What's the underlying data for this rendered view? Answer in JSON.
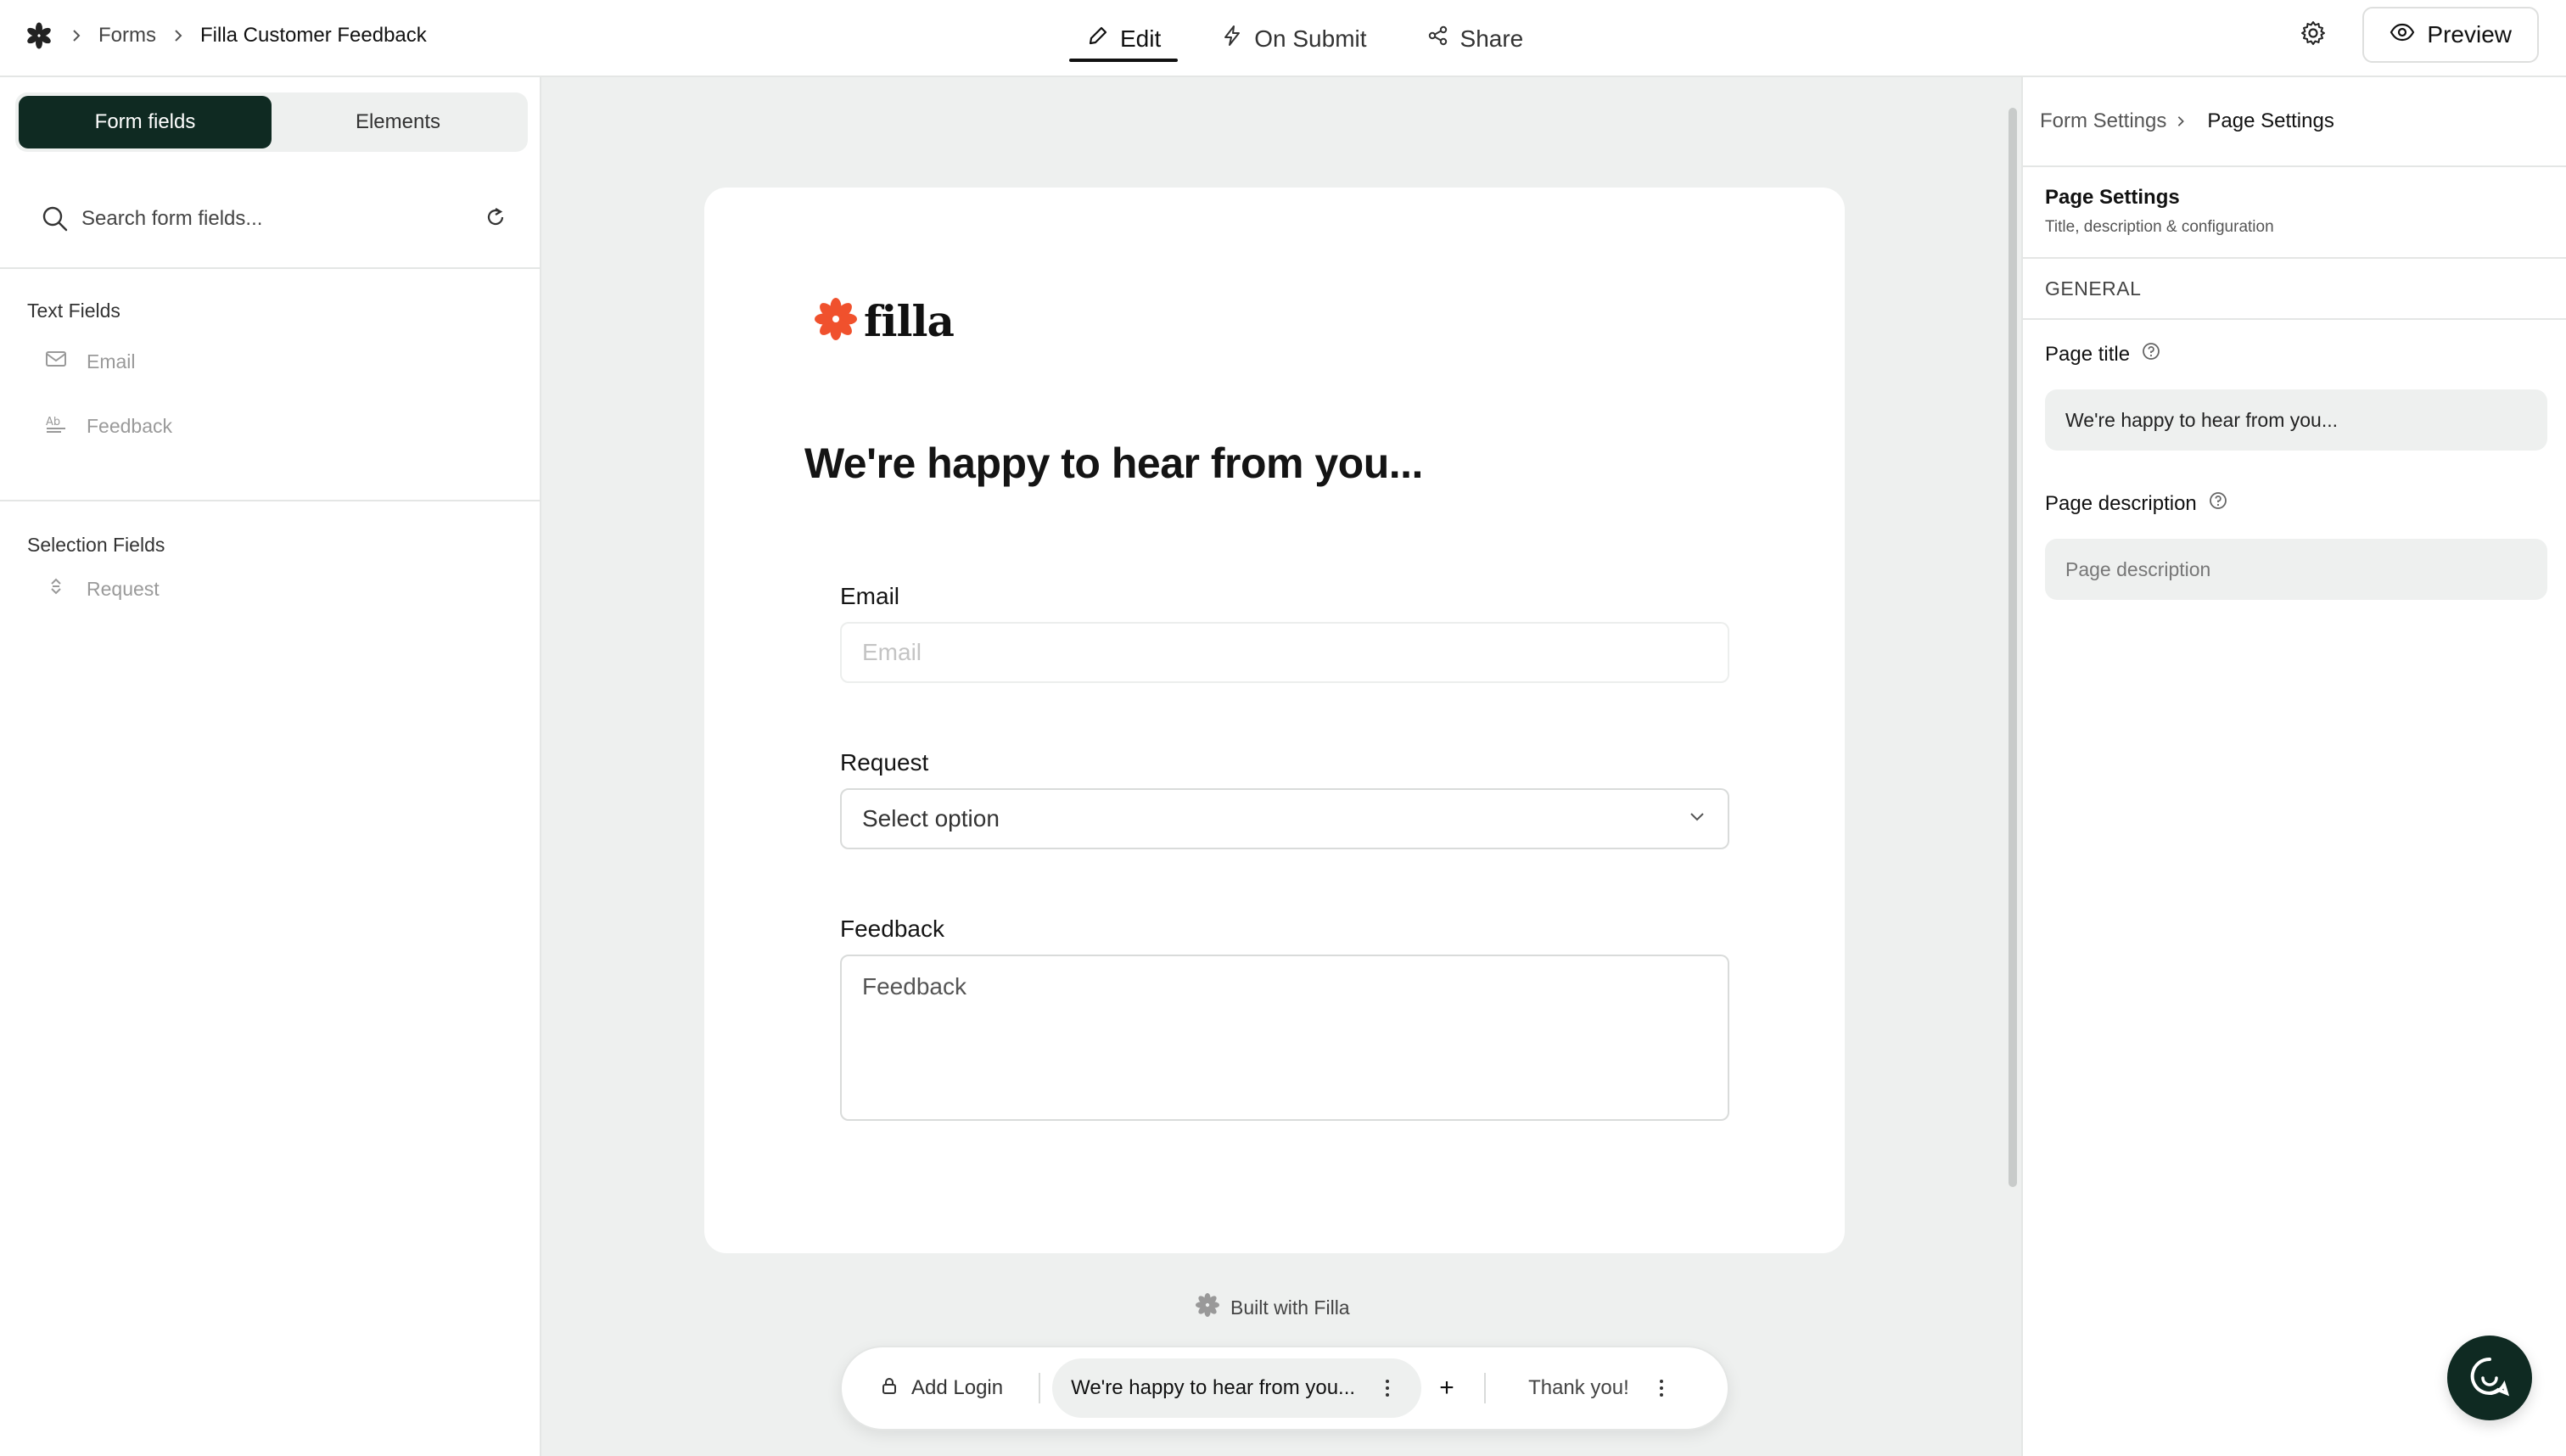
{
  "breadcrumb": {
    "items": [
      "Forms",
      "Filla Customer Feedback"
    ]
  },
  "tabs": [
    {
      "label": "Edit",
      "icon": "pencil-icon",
      "active": true
    },
    {
      "label": "On Submit",
      "icon": "bolt-icon",
      "active": false
    },
    {
      "label": "Share",
      "icon": "share-icon",
      "active": false
    }
  ],
  "header": {
    "preview_label": "Preview"
  },
  "left_panel": {
    "segments": [
      "Form fields",
      "Elements"
    ],
    "active_segment": "Form fields",
    "search_placeholder": "Search form fields...",
    "sections": [
      {
        "title": "Text Fields",
        "items": [
          {
            "label": "Email",
            "icon": "mail-icon"
          },
          {
            "label": "Feedback",
            "icon": "text-ab-icon"
          }
        ]
      },
      {
        "title": "Selection Fields",
        "items": [
          {
            "label": "Request",
            "icon": "select-icon"
          }
        ]
      }
    ]
  },
  "form": {
    "brand": "filla",
    "title": "We're happy to hear from you...",
    "fields": [
      {
        "label": "Email",
        "placeholder": "Email"
      },
      {
        "label": "Request",
        "value": "Select option"
      },
      {
        "label": "Feedback",
        "placeholder": "Feedback"
      }
    ],
    "built_with": "Built with Filla"
  },
  "page_bar": {
    "add_login": "Add Login",
    "current_page": "We're happy to hear from you...",
    "add": "+",
    "thanks_page": "Thank you!"
  },
  "right_panel": {
    "breadcrumb": [
      "Form Settings",
      "Page Settings"
    ],
    "title": "Page Settings",
    "subtitle": "Title, description & configuration",
    "section": "GENERAL",
    "page_title_label": "Page title",
    "page_title_value": "We're happy to hear from you...",
    "page_description_label": "Page description",
    "page_description_placeholder": "Page description"
  },
  "colors": {
    "accent_dark": "#0f2a22",
    "brand_orange": "#f0512d",
    "canvas_bg": "#eef0ef"
  }
}
